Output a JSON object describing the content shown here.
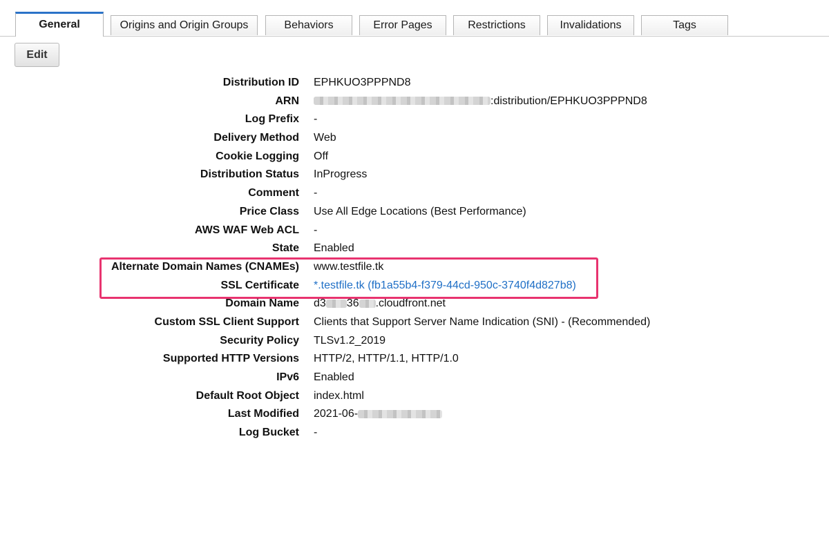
{
  "tabs": [
    {
      "label": "General",
      "active": true
    },
    {
      "label": "Origins and Origin Groups",
      "active": false
    },
    {
      "label": "Behaviors",
      "active": false
    },
    {
      "label": "Error Pages",
      "active": false
    },
    {
      "label": "Restrictions",
      "active": false
    },
    {
      "label": "Invalidations",
      "active": false
    },
    {
      "label": "Tags",
      "active": false
    }
  ],
  "toolbar": {
    "edit_label": "Edit"
  },
  "details": {
    "distribution_id": {
      "label": "Distribution ID",
      "value": "EPHKUO3PPPND8"
    },
    "arn": {
      "label": "ARN",
      "value_suffix": ":distribution/EPHKUO3PPPND8"
    },
    "log_prefix": {
      "label": "Log Prefix",
      "value": "-"
    },
    "delivery_method": {
      "label": "Delivery Method",
      "value": "Web"
    },
    "cookie_logging": {
      "label": "Cookie Logging",
      "value": "Off"
    },
    "distribution_status": {
      "label": "Distribution Status",
      "value": "InProgress"
    },
    "comment": {
      "label": "Comment",
      "value": "-"
    },
    "price_class": {
      "label": "Price Class",
      "value": "Use All Edge Locations (Best Performance)"
    },
    "aws_waf_web_acl": {
      "label": "AWS WAF Web ACL",
      "value": "-"
    },
    "state": {
      "label": "State",
      "value": "Enabled"
    },
    "alternate_domain_names": {
      "label": "Alternate Domain Names (CNAMEs)",
      "value": "www.testfile.tk"
    },
    "ssl_certificate": {
      "label": "SSL Certificate",
      "value": "*.testfile.tk (fb1a55b4-f379-44cd-950c-3740f4d827b8)"
    },
    "domain_name": {
      "label": "Domain Name",
      "value_part1": "d3",
      "value_part2": "36",
      "value_suffix": ".cloudfront.net"
    },
    "custom_ssl_client_support": {
      "label": "Custom SSL Client Support",
      "value": "Clients that Support Server Name Indication (SNI) - (Recommended)"
    },
    "security_policy": {
      "label": "Security Policy",
      "value": "TLSv1.2_2019"
    },
    "supported_http_versions": {
      "label": "Supported HTTP Versions",
      "value": "HTTP/2, HTTP/1.1, HTTP/1.0"
    },
    "ipv6": {
      "label": "IPv6",
      "value": "Enabled"
    },
    "default_root_object": {
      "label": "Default Root Object",
      "value": "index.html"
    },
    "last_modified": {
      "label": "Last Modified",
      "value_prefix": "2021-06-"
    },
    "log_bucket": {
      "label": "Log Bucket",
      "value": "-"
    }
  },
  "colors": {
    "accent_tab": "#2b73c8",
    "link": "#1f6fc6",
    "highlight_border": "#e8336f"
  }
}
